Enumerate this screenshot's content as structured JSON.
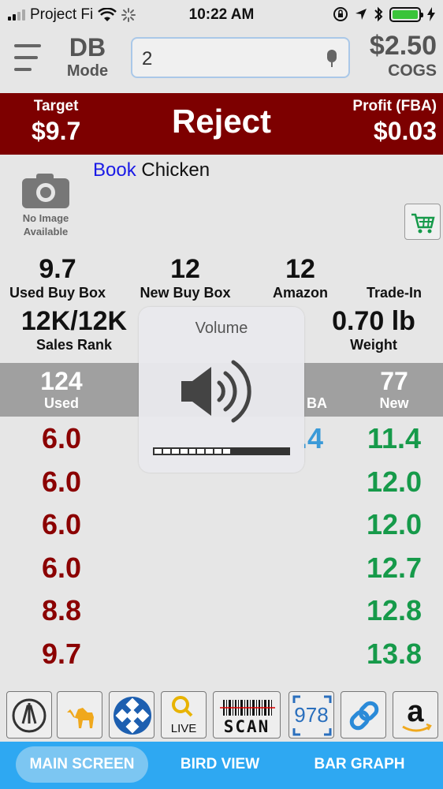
{
  "status_bar": {
    "carrier": "Project Fi",
    "time": "10:22 AM",
    "icons": [
      "signal-icon",
      "wifi-icon",
      "loading-icon",
      "orientation-lock-icon",
      "location-icon",
      "bluetooth-icon",
      "battery-icon",
      "charging-icon"
    ],
    "battery_color": "#3ac43a"
  },
  "header": {
    "mode_title": "DB",
    "mode_label": "Mode",
    "search_value": "2",
    "cogs_price": "$2.50",
    "cogs_label": "COGS"
  },
  "decision": {
    "target_label": "Target",
    "target_value": "$9.7",
    "verdict": "Reject",
    "profit_label": "Profit (FBA)",
    "profit_value": "$0.03",
    "color": "#7d0000"
  },
  "product": {
    "no_image_line1": "No Image",
    "no_image_line2": "Available",
    "type": "Book",
    "name": "Chicken"
  },
  "stats": {
    "used_buy_box": {
      "value": "9.7",
      "label": "Used Buy Box"
    },
    "new_buy_box": {
      "value": "12",
      "label": "New Buy Box"
    },
    "amazon": {
      "value": "12",
      "label": "Amazon"
    },
    "trade_in": {
      "label": "Trade-In"
    },
    "sales_rank": {
      "value": "12K/12K",
      "label": "Sales Rank"
    },
    "weight": {
      "value": "0.70 lb",
      "label": "Weight"
    }
  },
  "offers": {
    "used": {
      "count": "124",
      "label": "Used"
    },
    "fba": {
      "label": "BA",
      "first_price_partial": ".4"
    },
    "new": {
      "count": "77",
      "label": "New"
    }
  },
  "used_prices": [
    "6.0",
    "6.0",
    "6.0",
    "6.0",
    "8.8",
    "9.7"
  ],
  "new_prices": [
    "11.4",
    "12.0",
    "12.0",
    "12.7",
    "12.8",
    "13.8"
  ],
  "volume_hud": {
    "title": "Volume",
    "level": 0.57
  },
  "toolbar": {
    "tools": [
      "compass-icon",
      "camel-icon",
      "dots-icon",
      "live-search-icon",
      "barcode-scan-icon",
      "isbn-978-icon",
      "link-icon",
      "amazon-icon"
    ],
    "live_label": "LIVE",
    "scan_label": "SCAN",
    "isbn_label": "978",
    "amazon_letter": "a"
  },
  "tabs": {
    "main": "MAIN SCREEN",
    "bird": "BIRD VIEW",
    "bar": "BAR GRAPH",
    "active": "main"
  }
}
